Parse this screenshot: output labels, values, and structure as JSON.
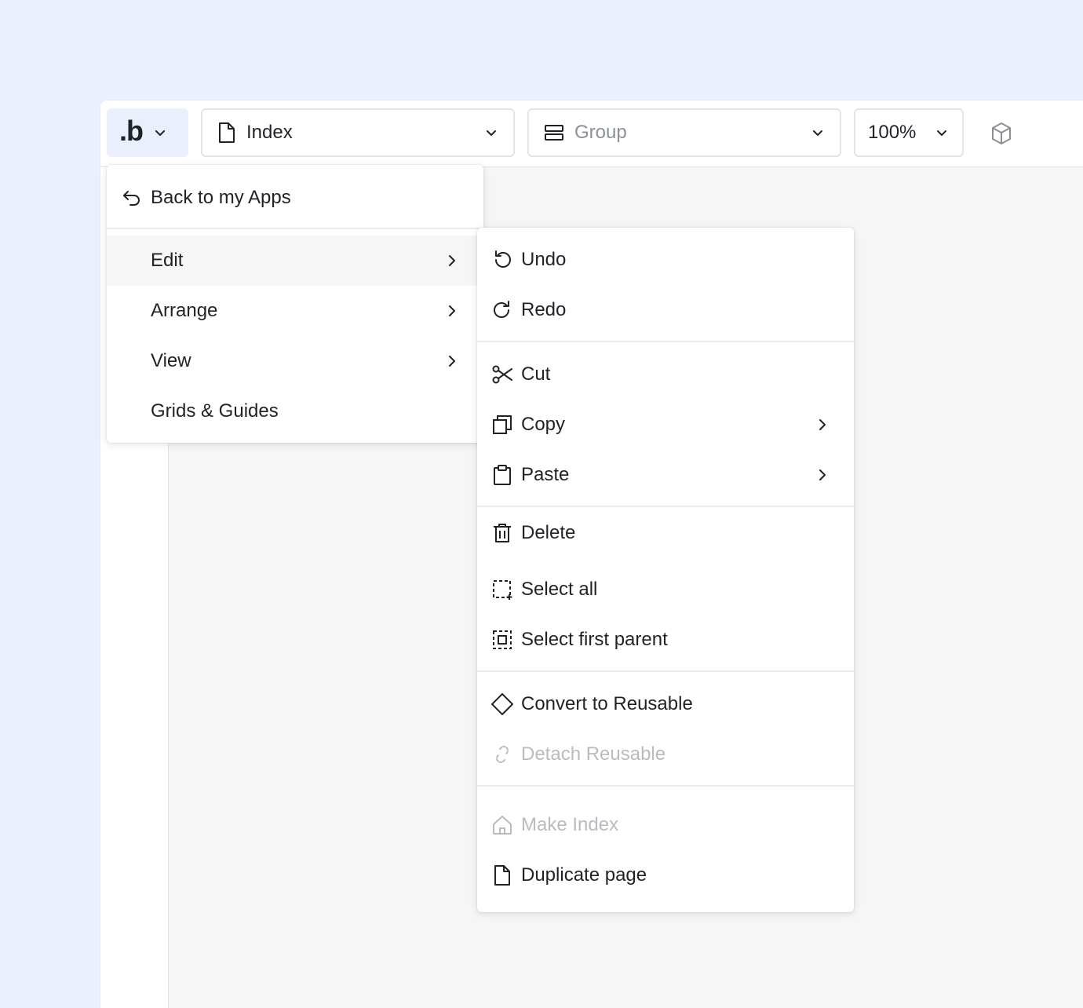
{
  "toolbar": {
    "logo": ".b",
    "page_label": "Index",
    "group_placeholder": "Group",
    "zoom": "100%"
  },
  "main_menu": {
    "back": "Back to my Apps",
    "items": [
      {
        "label": "Edit",
        "submenu": true,
        "highlighted": true
      },
      {
        "label": "Arrange",
        "submenu": true
      },
      {
        "label": "View",
        "submenu": true
      },
      {
        "label": "Grids & Guides",
        "submenu": false
      }
    ]
  },
  "edit_menu": {
    "undo": "Undo",
    "redo": "Redo",
    "cut": "Cut",
    "copy": "Copy",
    "paste": "Paste",
    "delete": "Delete",
    "select_all": "Select all",
    "select_first_parent": "Select first parent",
    "convert_to_reusable": "Convert to Reusable",
    "detach_reusable": "Detach Reusable",
    "make_index": "Make Index",
    "duplicate_page": "Duplicate page"
  },
  "colors": {
    "background": "#eaf1fd",
    "logo_button": "#e9f0fc",
    "text": "#1f2328",
    "disabled_text": "#b8bcc1",
    "highlight": "#f6f6f6",
    "canvas": "#f6f6f6"
  }
}
